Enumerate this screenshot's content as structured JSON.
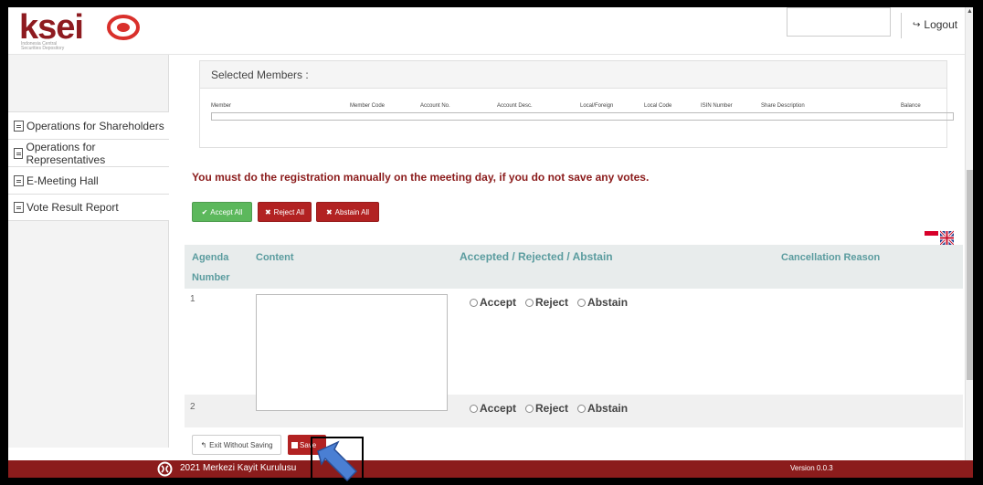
{
  "header": {
    "logo_text": "ksei",
    "logo_subtitle": "Indonesia Central Securities Depository",
    "logout_label": "Logout"
  },
  "sidebar": {
    "items": [
      {
        "label": "Operations for Shareholders"
      },
      {
        "label": "Operations for Representatives"
      },
      {
        "label": "E-Meeting Hall"
      },
      {
        "label": "Vote Result Report"
      }
    ]
  },
  "members": {
    "title": "Selected Members :",
    "columns": [
      "Member",
      "Member Code",
      "Account No.",
      "Account Desc.",
      "Local/Foreign",
      "Local Code",
      "ISIN Number",
      "Share Description",
      "Balance"
    ]
  },
  "warning": "You must do the registration manually on the meeting day, if you do not save any votes.",
  "bulk_actions": {
    "accept_all": "Accept All",
    "reject_all": "Reject All",
    "abstain_all": "Abstain All"
  },
  "agenda_table": {
    "headers": {
      "agenda_number_line1": "Agenda",
      "agenda_number_line2": "Number",
      "content": "Content",
      "vote": "Accepted / Rejected / Abstain",
      "cancellation": "Cancellation Reason"
    },
    "rows": [
      {
        "number": "1",
        "options": [
          "Accept",
          "Reject",
          "Abstain"
        ]
      },
      {
        "number": "2",
        "options": [
          "Accept",
          "Reject",
          "Abstain"
        ]
      }
    ]
  },
  "actions": {
    "exit_label": "Exit Without Saving",
    "save_label": "Save"
  },
  "footer": {
    "copyright": "2021 Merkezi Kayit Kurulusu",
    "version": "Version 0.0.3"
  },
  "colors": {
    "brand": "#8b1c1c",
    "accept": "#5cb85c",
    "danger": "#b22222",
    "table_header_text": "#5b9c9f",
    "table_header_bg": "#e8ecec",
    "cursor_arrow": "#4a7fd4"
  },
  "icons": [
    "logout-icon",
    "document-icon",
    "check-icon",
    "x-icon",
    "reply-arrow-icon",
    "floppy-disk-icon",
    "flag-id-icon",
    "flag-uk-icon",
    "cursor-arrow-icon",
    "footer-logo-icon"
  ]
}
